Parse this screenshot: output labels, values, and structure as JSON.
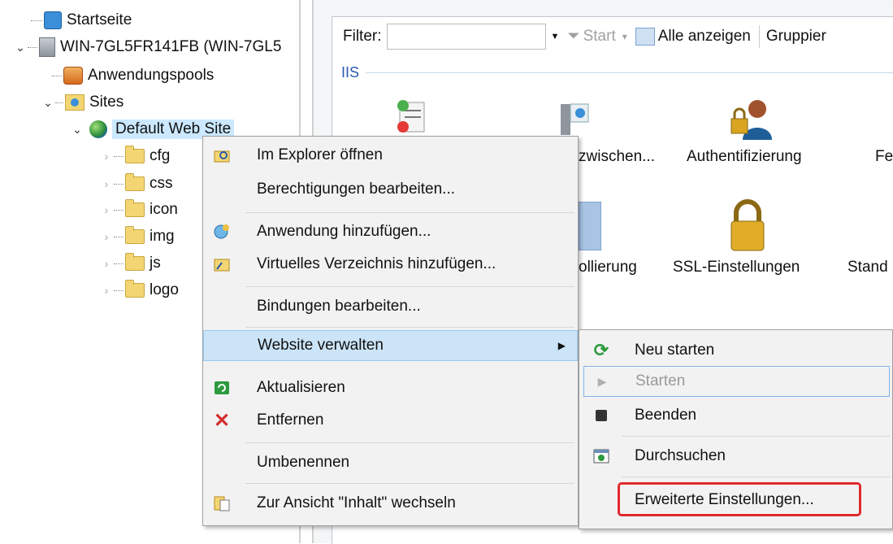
{
  "tree": {
    "items": [
      {
        "label": "Startseite",
        "icon": "home-icon"
      },
      {
        "label": "WIN-7GL5FR141FB (WIN-7GL5",
        "icon": "server-icon"
      },
      {
        "label": "Anwendungspools",
        "icon": "app-pool-icon"
      },
      {
        "label": "Sites",
        "icon": "sites-icon"
      },
      {
        "label": "Default Web Site",
        "icon": "globe-icon"
      },
      {
        "label": "cfg",
        "icon": "folder-icon"
      },
      {
        "label": "css",
        "icon": "folder-icon"
      },
      {
        "label": "icon",
        "icon": "folder-icon"
      },
      {
        "label": "img",
        "icon": "folder-icon"
      },
      {
        "label": "js",
        "icon": "folder-icon"
      },
      {
        "label": "logo",
        "icon": "folder-icon"
      }
    ]
  },
  "toolbar": {
    "filter_label": "Filter:",
    "filter_value": "",
    "start_label": "Start",
    "show_all_label": "Alle anzeigen",
    "group_label": "Gruppier"
  },
  "group": {
    "title": "IIS"
  },
  "features": [
    {
      "label": "zwischen...",
      "icon": "cache-icon"
    },
    {
      "label": "Authentifizierung",
      "icon": "authentication-icon"
    },
    {
      "label": "Fe",
      "icon": ""
    },
    {
      "label": "ollierung",
      "icon": "logging-icon"
    },
    {
      "label": "SSL-Einstellungen",
      "icon": "lock-icon"
    },
    {
      "label": "Stand",
      "icon": ""
    }
  ],
  "context_menu": {
    "items": [
      {
        "label": "Im Explorer öffnen",
        "icon": "explorer-icon"
      },
      {
        "label": "Berechtigungen bearbeiten...",
        "icon": ""
      },
      {
        "label": "Anwendung hinzufügen...",
        "icon": "add-application-icon"
      },
      {
        "label": "Virtuelles Verzeichnis hinzufügen...",
        "icon": "virtual-directory-icon"
      },
      {
        "label": "Bindungen bearbeiten...",
        "icon": ""
      },
      {
        "label": "Website verwalten",
        "icon": ""
      },
      {
        "label": "Aktualisieren",
        "icon": "refresh-icon"
      },
      {
        "label": "Entfernen",
        "icon": "remove-icon"
      },
      {
        "label": "Umbenennen",
        "icon": ""
      },
      {
        "label": "Zur Ansicht \"Inhalt\" wechseln",
        "icon": "content-view-icon"
      }
    ]
  },
  "submenu": {
    "items": [
      {
        "label": "Neu starten",
        "icon": "restart-icon"
      },
      {
        "label": "Starten",
        "icon": "play-icon"
      },
      {
        "label": "Beenden",
        "icon": "stop-icon"
      },
      {
        "label": "Durchsuchen",
        "icon": "browse-icon"
      },
      {
        "label": "Erweiterte Einstellungen...",
        "icon": ""
      }
    ]
  },
  "colors": {
    "highlight": "#e0292e",
    "selection": "#cce8ff",
    "menu_active": "#cce4f7"
  }
}
